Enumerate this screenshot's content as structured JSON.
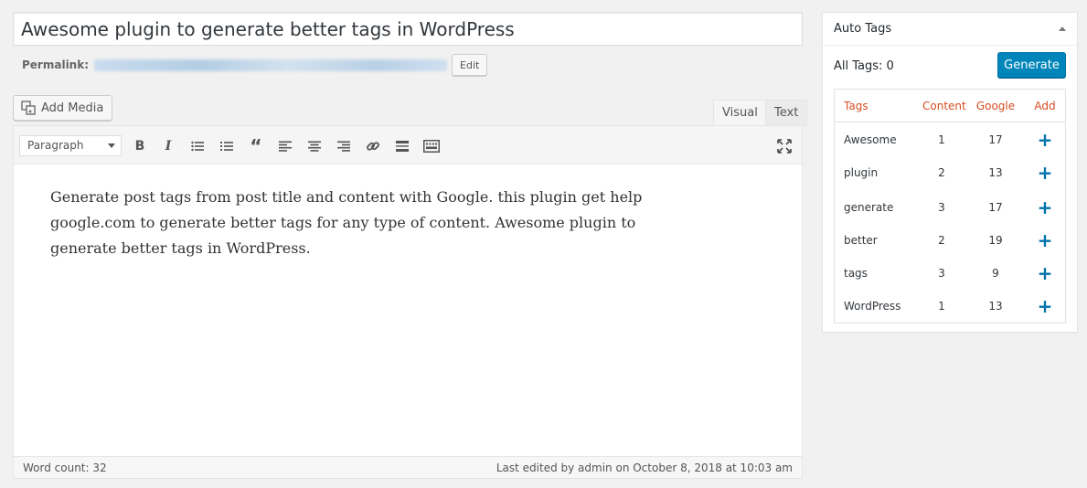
{
  "post": {
    "title": "Awesome plugin to generate better tags in WordPress",
    "permalink_label": "Permalink:",
    "edit_label": "Edit"
  },
  "media": {
    "add_media_label": "Add Media"
  },
  "editor": {
    "tabs": [
      "Visual",
      "Text"
    ],
    "format_select": "Paragraph",
    "content": "Generate post tags from post title and content with Google. this plugin get help google.com to generate better tags for any type of content. Awesome plugin to generate better tags in WordPress.",
    "word_count": "Word count: 32",
    "last_edited": "Last edited by admin on October 8, 2018 at 10:03 am",
    "toolbar_icons": [
      "bold-icon",
      "italic-icon",
      "bullet-list-icon",
      "numbered-list-icon",
      "blockquote-icon",
      "align-left-icon",
      "align-center-icon",
      "align-right-icon",
      "link-icon",
      "read-more-icon",
      "toolbar-toggle-icon",
      "fullscreen-icon"
    ]
  },
  "auto_tags": {
    "title": "Auto Tags",
    "all_tags": "All Tags: 0",
    "generate_label": "Generate",
    "columns": [
      "Tags",
      "Content",
      "Google",
      "Add"
    ],
    "rows": [
      {
        "tag": "Awesome",
        "content": "1",
        "google": "17"
      },
      {
        "tag": "plugin",
        "content": "2",
        "google": "13"
      },
      {
        "tag": "generate",
        "content": "3",
        "google": "17"
      },
      {
        "tag": "better",
        "content": "2",
        "google": "19"
      },
      {
        "tag": "tags",
        "content": "3",
        "google": "9"
      },
      {
        "tag": "WordPress",
        "content": "1",
        "google": "13"
      }
    ],
    "add_symbol": "+",
    "accent_color": "#d54e21",
    "primary_color": "#0085ba"
  }
}
